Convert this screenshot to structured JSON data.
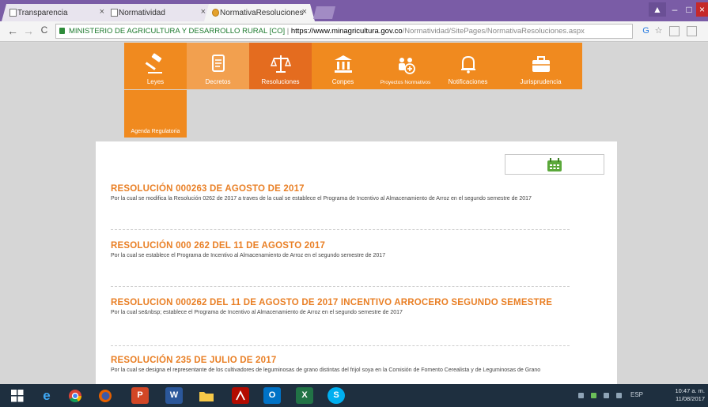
{
  "browser": {
    "tabs": [
      {
        "label": "Transparencia",
        "active": false
      },
      {
        "label": "Normatividad",
        "active": false
      },
      {
        "label": "NormativaResoluciones",
        "active": true
      }
    ],
    "tab_close_glyph": "×",
    "address": {
      "secure_label": "MINISTERIO DE AGRICULTURA Y DESARROLLO RURAL [CO]",
      "separator": "|",
      "scheme_host": "https://www.minagricultura.gov.co",
      "path": "/Normatividad/SitePages/NormativaResoluciones.aspx"
    },
    "nav": {
      "back": "←",
      "forward": "→",
      "reload": "C"
    },
    "window_controls": {
      "minimize": "–",
      "maximize": "□",
      "close": "×"
    }
  },
  "site_nav": {
    "tiles": [
      {
        "label": "Leyes",
        "icon": "gavel-icon"
      },
      {
        "label": "Decretos",
        "icon": "document-icon"
      },
      {
        "label": "Resoluciones",
        "icon": "scales-icon",
        "active": true
      },
      {
        "label": "Conpes",
        "icon": "building-icon"
      },
      {
        "label": "Proyectos Normativos",
        "icon": "people-icon"
      },
      {
        "label": "Notificaciones",
        "icon": "bell-icon"
      },
      {
        "label": "Jurisprudencia",
        "icon": "briefcase-icon"
      }
    ],
    "agenda_label": "Agenda Regulatoria"
  },
  "resoluciones": [
    {
      "title": "RESOLUCIÓN 000263 DE AGOSTO DE 2017",
      "desc": "Por la cual se modifica la Resolución 0262 de 2017 a traves de la cual se establece el Programa de Incentivo al Almacenamiento de Arroz en el segundo semestre de 2017"
    },
    {
      "title": "RESOLUCIÓN 000 262 DEL 11 DE AGOSTO 2017",
      "desc": "Por la cual se establece el Programa de Incentivo al Almacenamiento de Arroz en el segundo semestre de 2017"
    },
    {
      "title": "RESOLUCION 000262 DEL 11 DE AGOSTO DE 2017 INCENTIVO ARROCERO SEGUNDO SEMESTRE",
      "desc": "Por la cual se&nbsp; establece el Programa de Incentivo al Almacenamiento de Arroz en el segundo semestre de 2017"
    },
    {
      "title": "RESOLUCIÓN 235 DE JULIO DE 2017",
      "desc": "Por la cual se designa el representante de los cultivadores de leguminosas de grano distintas del frijol soya en la Comisión de Fomento Cerealista y de Leguminosas de Grano"
    }
  ],
  "taskbar": {
    "apps": [
      "windows-start",
      "internet-explorer",
      "chrome",
      "firefox",
      "powerpoint",
      "word",
      "file-explorer",
      "acrobat",
      "outlook",
      "excel",
      "skype"
    ],
    "app_glyphs": {
      "powerpoint": "P",
      "word": "W",
      "outlook": "O",
      "excel": "X",
      "skype": "S",
      "internet-explorer": "e"
    },
    "lang": "ESP",
    "time": "10:47 a. m.",
    "date": "11/08/2017"
  },
  "colors": {
    "accent_orange": "#f08a1f",
    "title_orange": "#e97f25",
    "tab_strip": "#7a5ca6",
    "taskbar": "#1e2f3f"
  }
}
